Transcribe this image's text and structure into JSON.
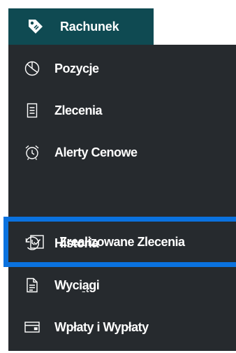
{
  "header": {
    "title": "Rachunek",
    "icon": "tag-icon",
    "background": "#0f4a52"
  },
  "menu": {
    "background": "#262a2e",
    "active_border_color": "#0a72df",
    "items": [
      {
        "label": "Pozycje",
        "icon": "pie-chart-icon"
      },
      {
        "label": "Zlecenia",
        "icon": "document-icon"
      },
      {
        "label": "Alerty Cenowe",
        "icon": "alarm-clock-icon"
      },
      {
        "label": "Zrealizowane Zlecenia",
        "icon": "checkbox-icon",
        "active": true
      },
      {
        "label": "Historia",
        "icon": "history-icon"
      },
      {
        "label": "Wyciągi",
        "label_prefix": "Wyci",
        "label_underlined": "ą",
        "label_suffix": "gi",
        "icon": "statement-icon"
      },
      {
        "label": "Wpłaty i Wypłaty",
        "icon": "card-icon"
      }
    ]
  }
}
